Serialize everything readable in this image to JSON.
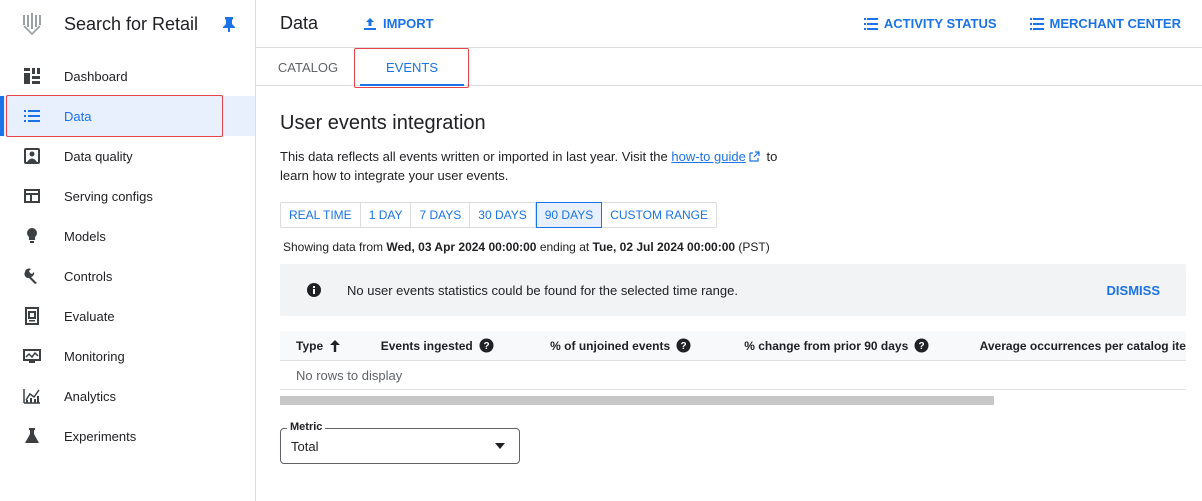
{
  "app": {
    "title": "Search for Retail"
  },
  "sidebar": {
    "items": [
      {
        "label": "Dashboard",
        "icon": "dashboard-icon"
      },
      {
        "label": "Data",
        "icon": "list-icon",
        "active": true
      },
      {
        "label": "Data quality",
        "icon": "data-quality-icon"
      },
      {
        "label": "Serving configs",
        "icon": "serving-configs-icon"
      },
      {
        "label": "Models",
        "icon": "lightbulb-icon"
      },
      {
        "label": "Controls",
        "icon": "wrench-icon"
      },
      {
        "label": "Evaluate",
        "icon": "evaluate-icon"
      },
      {
        "label": "Monitoring",
        "icon": "monitoring-icon"
      },
      {
        "label": "Analytics",
        "icon": "analytics-icon"
      },
      {
        "label": "Experiments",
        "icon": "flask-icon"
      }
    ]
  },
  "header": {
    "title": "Data",
    "import_label": "IMPORT",
    "activity_label": "ACTIVITY STATUS",
    "merchant_label": "MERCHANT CENTER"
  },
  "tabs": [
    {
      "label": "CATALOG"
    },
    {
      "label": "EVENTS",
      "active": true
    }
  ],
  "main": {
    "section_title": "User events integration",
    "desc_before": "This data reflects all events written or imported in last year. Visit the ",
    "desc_link": "how-to guide",
    "desc_after": " to learn how to integrate your user events.",
    "ranges": [
      "REAL TIME",
      "1 DAY",
      "7 DAYS",
      "30 DAYS",
      "90 DAYS",
      "CUSTOM RANGE"
    ],
    "selected_range": "90 DAYS",
    "showing_prefix": "Showing data from ",
    "showing_from": "Wed, 03 Apr 2024 00:00:00",
    "showing_mid": " ending at ",
    "showing_to": "Tue, 02 Jul 2024 00:00:00",
    "showing_suffix": " (PST)",
    "banner_message": "No user events statistics could be found for the selected time range.",
    "banner_dismiss": "DISMISS",
    "table": {
      "columns": [
        "Type",
        "Events ingested",
        "% of unjoined events",
        "% change from prior 90 days",
        "Average occurrences per catalog ite"
      ],
      "empty_text": "No rows to display"
    },
    "metric": {
      "label": "Metric",
      "value": "Total"
    }
  },
  "colors": {
    "accent": "#1a73e8",
    "highlight": "#e8434b"
  }
}
